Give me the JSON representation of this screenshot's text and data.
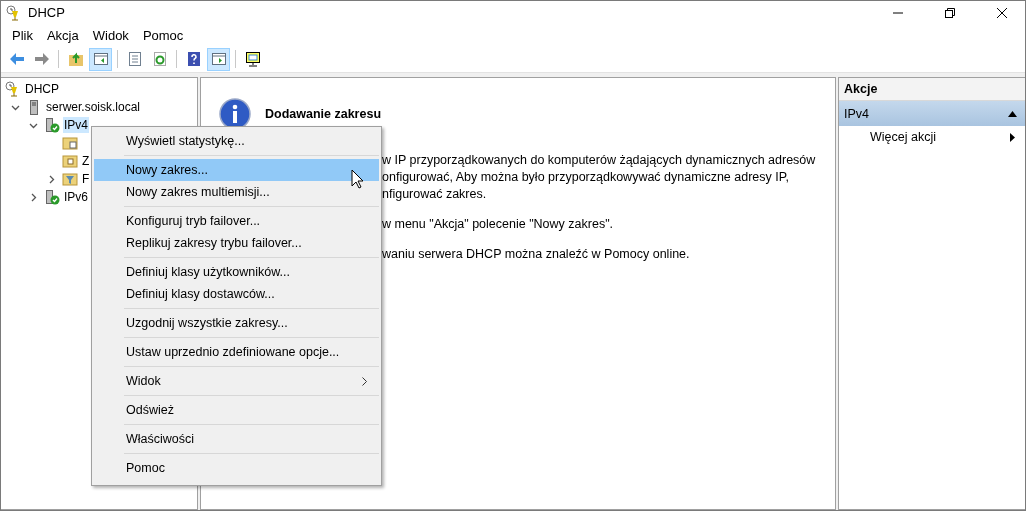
{
  "window": {
    "title": "DHCP"
  },
  "menu_bar": [
    "Plik",
    "Akcja",
    "Widok",
    "Pomoc"
  ],
  "toolbar": [
    {
      "kind": "back",
      "pressed": false
    },
    {
      "kind": "forward",
      "pressed": false
    },
    {
      "kind": "up",
      "pressed": false
    },
    {
      "kind": "tree-pane",
      "pressed": true
    },
    {
      "kind": "export",
      "pressed": false
    },
    {
      "kind": "refresh",
      "pressed": false
    },
    {
      "kind": "help",
      "pressed": false
    },
    {
      "kind": "action-pane",
      "pressed": true
    },
    {
      "kind": "monitor",
      "pressed": false
    }
  ],
  "tree": [
    {
      "label": "DHCP",
      "kind": "root",
      "selected": false,
      "children": [
        {
          "label": "serwer.soisk.local",
          "kind": "server",
          "selected": false,
          "expanded": true,
          "children": [
            {
              "label": "IPv4",
              "kind": "ip",
              "selected": true,
              "expanded": true,
              "children": [
                {
                  "kind": "folder-stats",
                  "selected": false
                },
                {
                  "label": "Z",
                  "kind": "folder",
                  "selected": false
                },
                {
                  "label": "F",
                  "kind": "filter",
                  "selected": false,
                  "expanded": false
                }
              ]
            },
            {
              "label": "IPv6",
              "kind": "ip",
              "selected": false,
              "expanded": false
            }
          ]
        }
      ]
    }
  ],
  "content": {
    "title": "Dodawanie zakresu",
    "paragraphs": [
      [
        "w IP przyporządkowanych do komputerów żądających dynamicznych adresów",
        "onfigurować, Aby można było przyporządkowywać dynamiczne adresy IP,",
        "nfigurować zakres."
      ],
      [
        "w menu \"Akcja\" polecenie \"Nowy zakres\"."
      ],
      [
        "waniu serwera DHCP można znaleźć w Pomocy online."
      ]
    ]
  },
  "actions": {
    "header": "Akcje",
    "sections": [
      {
        "title": "IPv4",
        "expanded": true,
        "items": [
          {
            "label": "Więcej akcji",
            "submenu": true
          }
        ]
      }
    ]
  },
  "context_menu": {
    "groups": [
      [
        {
          "label": "Wyświetl statystykę...",
          "selected": false,
          "submenu": false
        }
      ],
      [
        {
          "label": "Nowy zakres...",
          "selected": true,
          "submenu": false
        },
        {
          "label": "Nowy zakres multiemisji...",
          "selected": false,
          "submenu": false
        }
      ],
      [
        {
          "label": "Konfiguruj tryb failover...",
          "selected": false,
          "submenu": false
        },
        {
          "label": "Replikuj zakresy trybu failover...",
          "selected": false,
          "submenu": false
        }
      ],
      [
        {
          "label": "Definiuj klasy użytkowników...",
          "selected": false,
          "submenu": false
        },
        {
          "label": "Definiuj klasy dostawców...",
          "selected": false,
          "submenu": false
        }
      ],
      [
        {
          "label": "Uzgodnij wszystkie zakresy...",
          "selected": false,
          "submenu": false
        }
      ],
      [
        {
          "label": "Ustaw uprzednio zdefiniowane opcje...",
          "selected": false,
          "submenu": false
        }
      ],
      [
        {
          "label": "Widok",
          "selected": false,
          "submenu": true
        }
      ],
      [
        {
          "label": "Odśwież",
          "selected": false,
          "submenu": false
        }
      ],
      [
        {
          "label": "Właściwości",
          "selected": false,
          "submenu": false
        }
      ],
      [
        {
          "label": "Pomoc",
          "selected": false,
          "submenu": false
        }
      ]
    ]
  }
}
